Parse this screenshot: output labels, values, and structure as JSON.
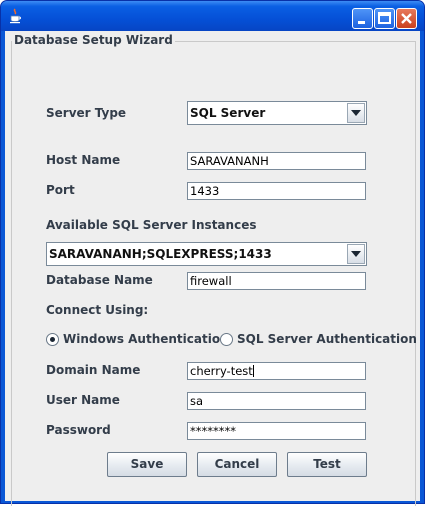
{
  "window": {
    "title_icon": "java-cup-icon",
    "controls": [
      "minimize-icon",
      "maximize-icon",
      "close-icon"
    ]
  },
  "group": {
    "title": "Database Setup Wizard"
  },
  "form": {
    "server_type": {
      "label": "Server Type",
      "value": "SQL Server"
    },
    "host_name": {
      "label": "Host Name",
      "value": "SARAVANANH"
    },
    "port": {
      "label": "Port",
      "value": "1433"
    },
    "instances": {
      "label": "Available SQL Server Instances",
      "value": "SARAVANANH;SQLEXPRESS;1433"
    },
    "database_name": {
      "label": "Database Name",
      "value": "firewall"
    },
    "connect_using": {
      "label": "Connect Using:",
      "options": [
        {
          "label": "Windows Authentication",
          "selected": true
        },
        {
          "label": "SQL Server Authentication",
          "selected": false
        }
      ]
    },
    "domain_name": {
      "label": "Domain Name",
      "value": "cherry-test"
    },
    "user_name": {
      "label": "User Name",
      "value": "sa"
    },
    "password": {
      "label": "Password",
      "value": "********"
    }
  },
  "buttons": {
    "save": "Save",
    "cancel": "Cancel",
    "test": "Test"
  },
  "colors": {
    "title_bar": "#0a57d6",
    "dialog_bg": "#eeeeee",
    "label_text": "#333d4a",
    "close_button": "#c9401e"
  }
}
